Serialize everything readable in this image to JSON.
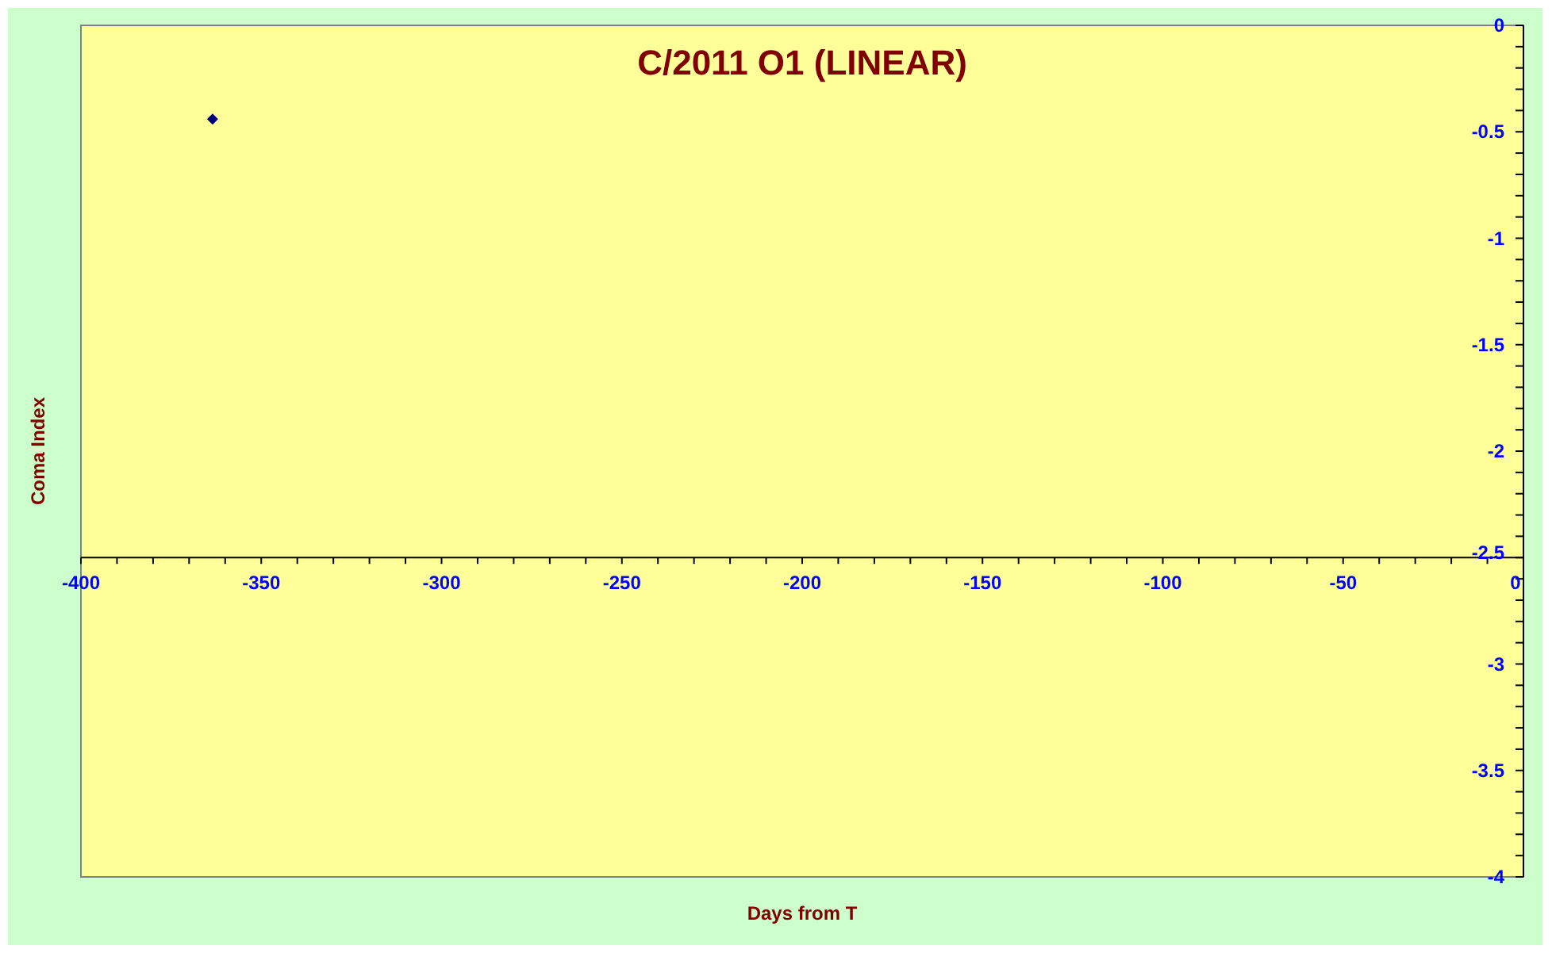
{
  "chart": {
    "chart_data": {
      "type": "scatter",
      "title": "C/2011 O1 (LINEAR)",
      "xlabel": "Days from T",
      "ylabel": "Coma Index",
      "series": [
        {
          "color": "#000080",
          "x": [
            -363.5
          ],
          "values": [
            -0.44
          ]
        }
      ],
      "xlim": [
        -400,
        0
      ],
      "ylim": [
        -4,
        0
      ],
      "xticks": [
        -400,
        -350,
        -300,
        -250,
        -200,
        -150,
        -100,
        -50,
        0
      ],
      "yticks": [
        0,
        -0.5,
        -1,
        -1.5,
        -2,
        -2.5,
        -3,
        -3.5,
        -4
      ]
    }
  }
}
